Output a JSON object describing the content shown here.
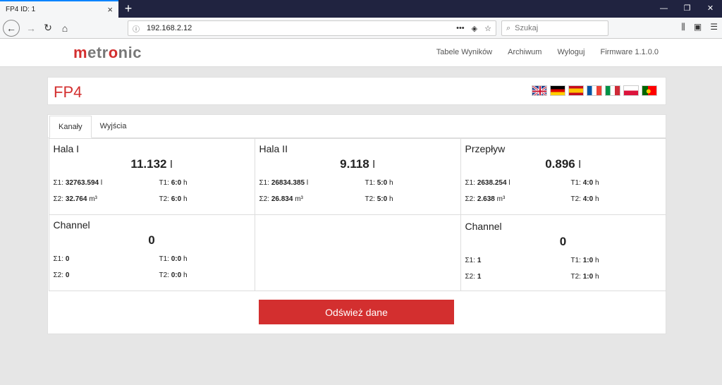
{
  "browser": {
    "tab_title": "FP4 ID: 1",
    "url": "192.168.2.12",
    "search_placeholder": "Szukaj"
  },
  "site": {
    "logo_prefix": "m",
    "logo_mid1": "e",
    "logo_mid2": "tr",
    "logo_o": "o",
    "logo_suffix": "nic",
    "nav": [
      "Tabele Wyników",
      "Archiwum",
      "Wyloguj",
      "Firmware 1.1.0.0"
    ]
  },
  "page": {
    "title": "FP4",
    "flags": [
      "en",
      "de",
      "es",
      "fr",
      "it",
      "pl",
      "pt"
    ],
    "tabs": [
      "Kanały",
      "Wyjścia"
    ],
    "refresh_label": "Odśwież dane"
  },
  "channels": [
    {
      "name": "Hala I",
      "value": "11.132",
      "unit": "l",
      "s1": "32763.594",
      "s1_unit": "l",
      "s2": "32.764",
      "s2_unit": "m³",
      "t1": "6:0",
      "t2": "6:0"
    },
    {
      "name": "Hala II",
      "value": "9.118",
      "unit": "l",
      "s1": "26834.385",
      "s1_unit": "l",
      "s2": "26.834",
      "s2_unit": "m³",
      "t1": "5:0",
      "t2": "5:0"
    },
    {
      "name": "Przepływ",
      "value": "0.896",
      "unit": "l",
      "s1": "2638.254",
      "s1_unit": "l",
      "s2": "2.638",
      "s2_unit": "m³",
      "t1": "4:0",
      "t2": "4:0"
    },
    {
      "name": "Channel",
      "value": "0",
      "unit": "",
      "s1": "0",
      "s1_unit": "",
      "s2": "0",
      "s2_unit": "",
      "t1": "0:0",
      "t2": "0:0"
    },
    {
      "name": "Channel",
      "value": "0",
      "unit": "",
      "s1": "1",
      "s1_unit": "",
      "s2": "1",
      "s2_unit": "",
      "t1": "1:0",
      "t2": "1:0"
    }
  ],
  "labels": {
    "s1": "Σ1:",
    "s2": "Σ2:",
    "t1": "T1:",
    "t2": "T2:",
    "h": "h"
  }
}
